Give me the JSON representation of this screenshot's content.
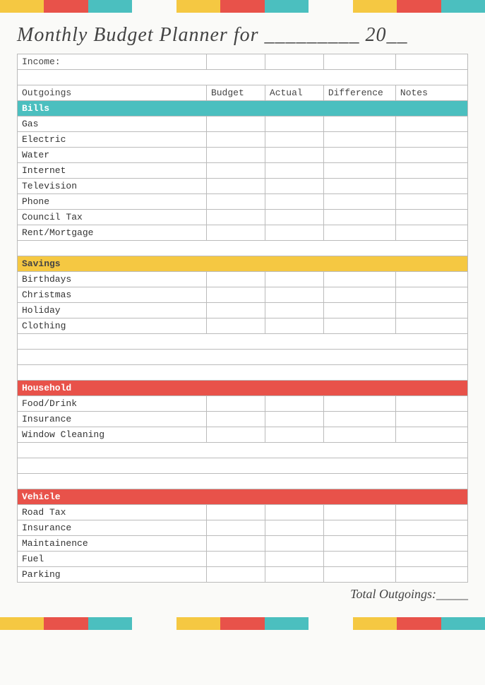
{
  "page": {
    "title": "Monthly Budget Planner for _________ 20__",
    "total_label": "Total Outgoings:_____"
  },
  "top_bar_colors": [
    "yellow",
    "red",
    "teal",
    "white",
    "yellow",
    "red",
    "teal",
    "white",
    "yellow",
    "red",
    "teal"
  ],
  "bottom_bar_colors": [
    "yellow",
    "red",
    "teal",
    "white",
    "yellow",
    "red",
    "teal",
    "white",
    "yellow",
    "red",
    "teal"
  ],
  "income_label": "Income:",
  "columns": {
    "outgoings": "Outgoings",
    "budget": "Budget",
    "actual": "Actual",
    "difference": "Difference",
    "notes": "Notes"
  },
  "sections": {
    "bills": {
      "label": "Bills",
      "items": [
        "Gas",
        "Electric",
        "Water",
        "Internet",
        "Television",
        "Phone",
        "Council Tax",
        "Rent/Mortgage"
      ]
    },
    "savings": {
      "label": "Savings",
      "items": [
        "Birthdays",
        "Christmas",
        "Holiday",
        "Clothing"
      ]
    },
    "household": {
      "label": "Household",
      "items": [
        "Food/Drink",
        "Insurance",
        "Window Cleaning"
      ]
    },
    "vehicle": {
      "label": "Vehicle",
      "items": [
        "Road Tax",
        "Insurance",
        "Maintainence",
        "Fuel",
        "Parking"
      ]
    }
  }
}
